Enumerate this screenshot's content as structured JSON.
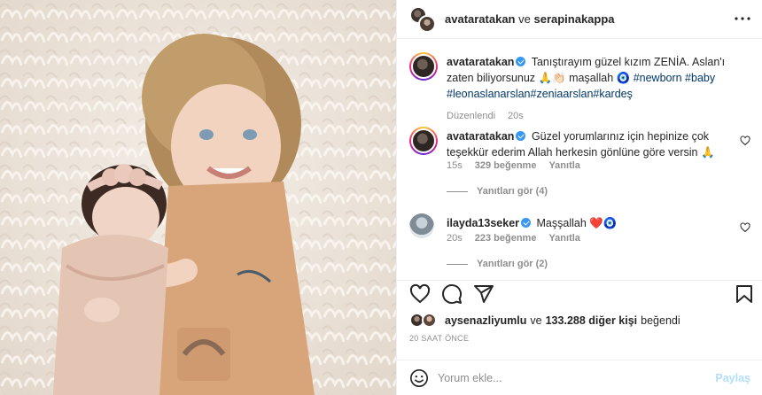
{
  "header": {
    "user1": "avataratakan",
    "joiner": "ve",
    "user2": "serapinakappa"
  },
  "caption": {
    "username": "avataratakan",
    "text": "Tanıştırayım güzel kızım ZENİA. Aslan'ı zaten biliyorsunuz 🙏👏🏻 maşallah 🧿",
    "hashtags": "#newborn #baby #leonaslanarslan#zeniaarslan#kardeş",
    "edited_label": "Düzenlendi",
    "time": "20s"
  },
  "comments": [
    {
      "username": "avataratakan",
      "text": "Güzel yorumlarınız için hepinize çok teşekkür ederim Allah herkesin gönlüne göre versin 🙏",
      "time": "15s",
      "likes": "329 beğenme",
      "reply_label": "Yanıtla",
      "view_replies": "Yanıtları gör (4)"
    },
    {
      "username": "ilayda13seker",
      "text": "Maşşallah ❤️🧿",
      "time": "20s",
      "likes": "223 beğenme",
      "reply_label": "Yanıtla",
      "view_replies": "Yanıtları gör (2)"
    }
  ],
  "likes": {
    "first_user": "aysenazliyumlu",
    "joiner": "ve",
    "others": "133.288 diğer kişi",
    "suffix": "beğendi"
  },
  "timestamp": "20 SAAT ÖNCE",
  "add_comment": {
    "placeholder": "Yorum ekle...",
    "post_label": "Paylaş"
  },
  "icons": {
    "more": "more-icon",
    "like": "heart-icon",
    "comment": "comment-icon",
    "share": "share-icon",
    "save": "bookmark-icon",
    "emoji": "emoji-icon"
  },
  "colors": {
    "link": "#00376b",
    "verified": "#3897f0",
    "muted": "#8e8e8e",
    "post_disabled": "#b2dffc"
  }
}
